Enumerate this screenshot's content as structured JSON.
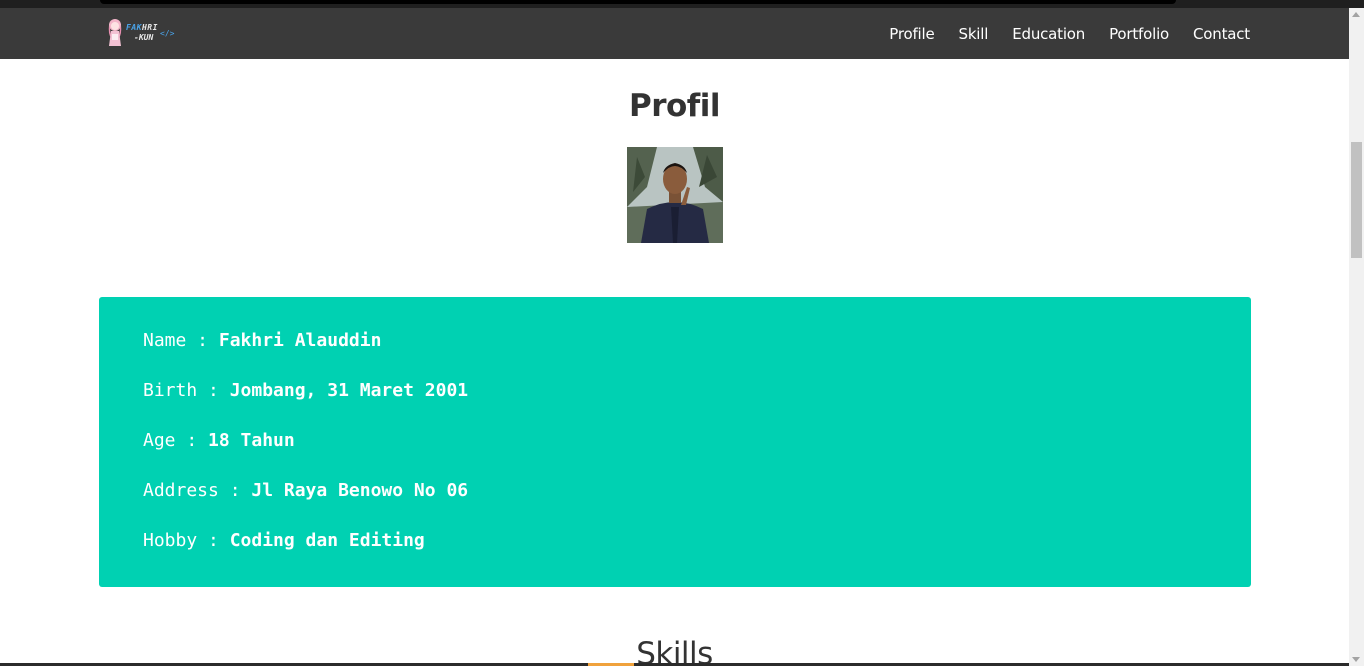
{
  "logo": {
    "line1_a": "FAK",
    "line1_b": "HRI",
    "line2": "-KUN",
    "tag": "</>"
  },
  "nav": {
    "items": [
      "Profile",
      "Skill",
      "Education",
      "Portfolio",
      "Contact"
    ]
  },
  "profile": {
    "heading": "Profil",
    "fields": [
      {
        "label": "Name : ",
        "value": "Fakhri Alauddin"
      },
      {
        "label": "Birth : ",
        "value": "Jombang, 31 Maret 2001"
      },
      {
        "label": "Age : ",
        "value": "18 Tahun"
      },
      {
        "label": "Address : ",
        "value": "Jl Raya Benowo No 06"
      },
      {
        "label": "Hobby : ",
        "value": "Coding dan Editing"
      }
    ]
  },
  "skills": {
    "heading": "Skills"
  },
  "colors": {
    "navbar": "#3a3a3a",
    "card": "#00d1b2",
    "text": "#333333"
  }
}
